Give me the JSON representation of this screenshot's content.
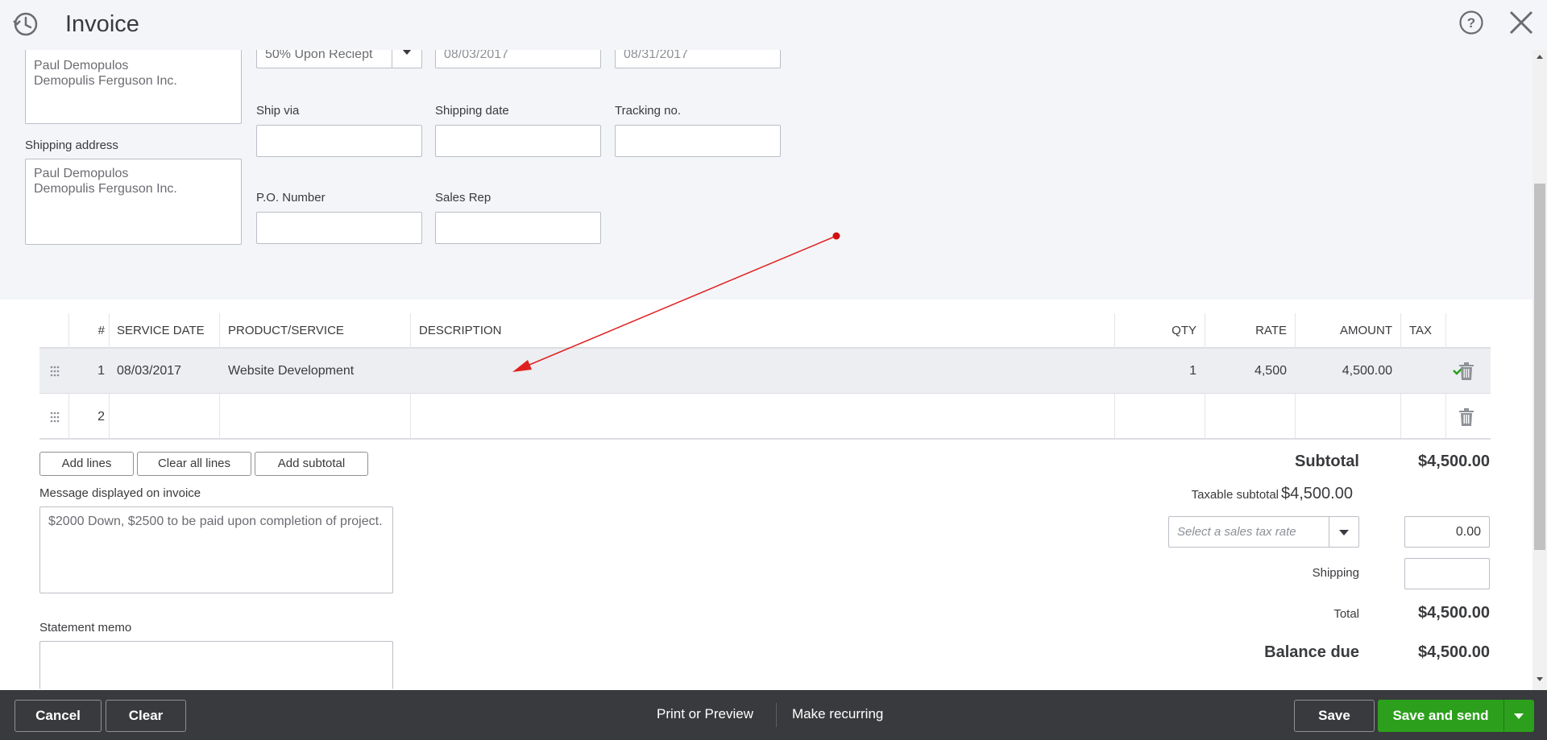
{
  "header": {
    "title": "Invoice"
  },
  "form": {
    "terms_value": "50% Upon Reciept",
    "invoice_date": "08/03/2017",
    "due_date": "08/31/2017",
    "billing_address": [
      "Paul Demopulos",
      "Demopulis Ferguson Inc."
    ],
    "shipping_address_label": "Shipping address",
    "shipping_address": [
      "Paul Demopulos",
      "Demopulis Ferguson Inc."
    ],
    "ship_via_label": "Ship via",
    "shipping_date_label": "Shipping date",
    "tracking_label": "Tracking no.",
    "po_label": "P.O. Number",
    "sales_rep_label": "Sales Rep"
  },
  "table": {
    "headers": [
      "#",
      "SERVICE DATE",
      "PRODUCT/SERVICE",
      "DESCRIPTION",
      "QTY",
      "RATE",
      "AMOUNT",
      "TAX"
    ],
    "rows": [
      {
        "num": "1",
        "service_date": "08/03/2017",
        "product": "Website Development",
        "description": "",
        "qty": "1",
        "rate": "4,500",
        "amount": "4,500.00",
        "tax": true
      },
      {
        "num": "2",
        "service_date": "",
        "product": "",
        "description": "",
        "qty": "",
        "rate": "",
        "amount": "",
        "tax": false
      }
    ]
  },
  "actions": {
    "add_lines": "Add lines",
    "clear_all_lines": "Clear all lines",
    "add_subtotal": "Add subtotal"
  },
  "message": {
    "label": "Message displayed on invoice",
    "text": "$2000 Down, $2500 to be paid upon completion of project."
  },
  "memo": {
    "label": "Statement memo",
    "text": ""
  },
  "totals": {
    "subtotal_label": "Subtotal",
    "subtotal_value": "$4,500.00",
    "taxable_label": "Taxable subtotal",
    "taxable_value": "$4,500.00",
    "tax_rate_placeholder": "Select a sales tax rate",
    "tax_amount": "0.00",
    "shipping_label": "Shipping",
    "shipping_value": "",
    "total_label": "Total",
    "total_value": "$4,500.00",
    "balance_label": "Balance due",
    "balance_value": "$4,500.00"
  },
  "footer": {
    "cancel": "Cancel",
    "clear": "Clear",
    "print_preview": "Print or Preview",
    "make_recurring": "Make recurring",
    "save": "Save",
    "save_and_send": "Save and send"
  },
  "colors": {
    "primary_green": "#2ca01c",
    "footer_bg": "#393a3d",
    "form_bg": "#f4f5f8",
    "annotation_red": "#e02020"
  }
}
